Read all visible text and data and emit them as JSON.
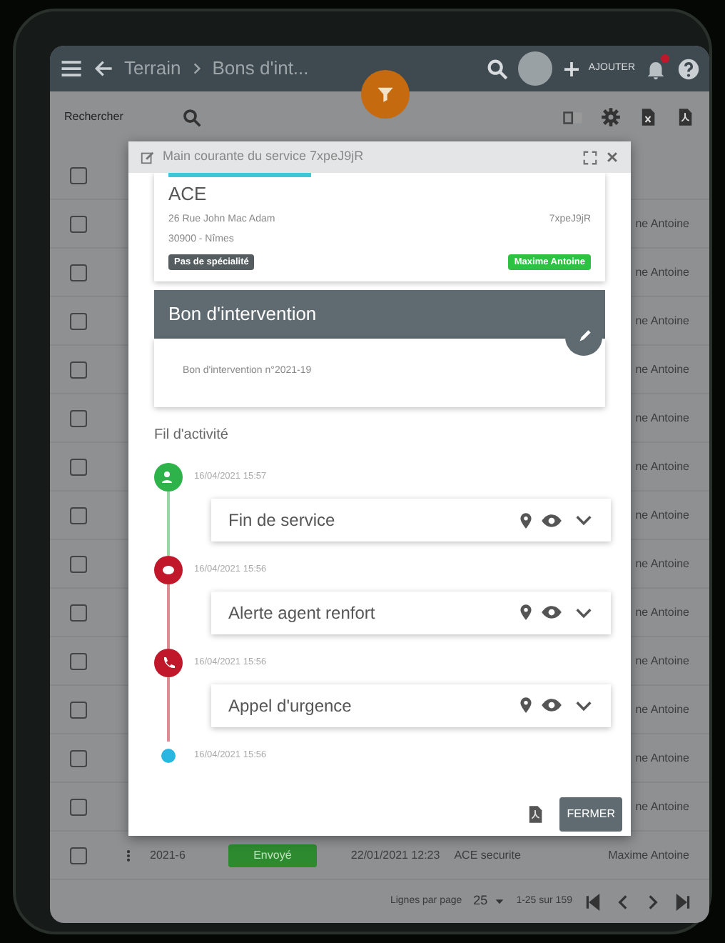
{
  "top_bar": {
    "breadcrumb": [
      "Terrain",
      "Bons d'int..."
    ],
    "add_label": "AJOUTER",
    "notification_dot": true
  },
  "toolbar": {
    "search_placeholder": "Rechercher"
  },
  "table": {
    "rows": [
      {
        "checked": false,
        "column_6": ""
      },
      {
        "checked": false,
        "column_6": "ne Antoine"
      },
      {
        "checked": false,
        "column_6": "ne Antoine"
      },
      {
        "checked": false,
        "column_6": "ne Antoine"
      },
      {
        "checked": false,
        "column_6": "ne Antoine"
      },
      {
        "checked": false,
        "column_6": "ne Antoine"
      },
      {
        "checked": false,
        "column_6": "ne Antoine"
      },
      {
        "checked": false,
        "column_6": "ne Antoine"
      },
      {
        "checked": false,
        "column_6": "ne Antoine"
      },
      {
        "checked": false,
        "column_6": "ne Antoine"
      },
      {
        "checked": false,
        "column_6": "ne Antoine"
      },
      {
        "checked": false,
        "column_6": "ne Antoine"
      },
      {
        "checked": false,
        "column_6": "ne Antoine"
      },
      {
        "checked": false,
        "column_6": "ne Antoine"
      },
      {
        "checked": false,
        "number": "2021-6",
        "status": "Envoyé",
        "date": "22/01/2021 12:23",
        "client": "ACE securite",
        "column_6": "Maxime Antoine"
      }
    ]
  },
  "pagination": {
    "rows_label": "Lignes par page",
    "rows_per_page": "25",
    "range": "1-25 sur 159"
  },
  "modal": {
    "title": "Main courante du service 7xpeJ9jR",
    "client": {
      "name": "ACE",
      "address": "26 Rue John Mac Adam",
      "code": "7xpeJ9jR",
      "city": "30900 - Nîmes",
      "specialty": "Pas de spécialité",
      "agent": "Maxime Antoine"
    },
    "section": {
      "title": "Bon d'intervention",
      "text": "Bon d'intervention n°2021-19"
    },
    "feed_title": "Fil d'activité",
    "timeline": [
      {
        "kind": "person",
        "color": "#2db34a",
        "date": "16/04/2021 15:57",
        "title": "Fin de service"
      },
      {
        "kind": "message",
        "color": "#c0182a",
        "date": "16/04/2021 15:56",
        "title": "Alerte agent renfort"
      },
      {
        "kind": "call",
        "color": "#c0182a",
        "date": "16/04/2021 15:56",
        "title": "Appel d'urgence"
      },
      {
        "kind": "marker",
        "color": "#29b6e0",
        "date": "16/04/2021 15:56"
      }
    ],
    "close_label": "FERMER"
  }
}
